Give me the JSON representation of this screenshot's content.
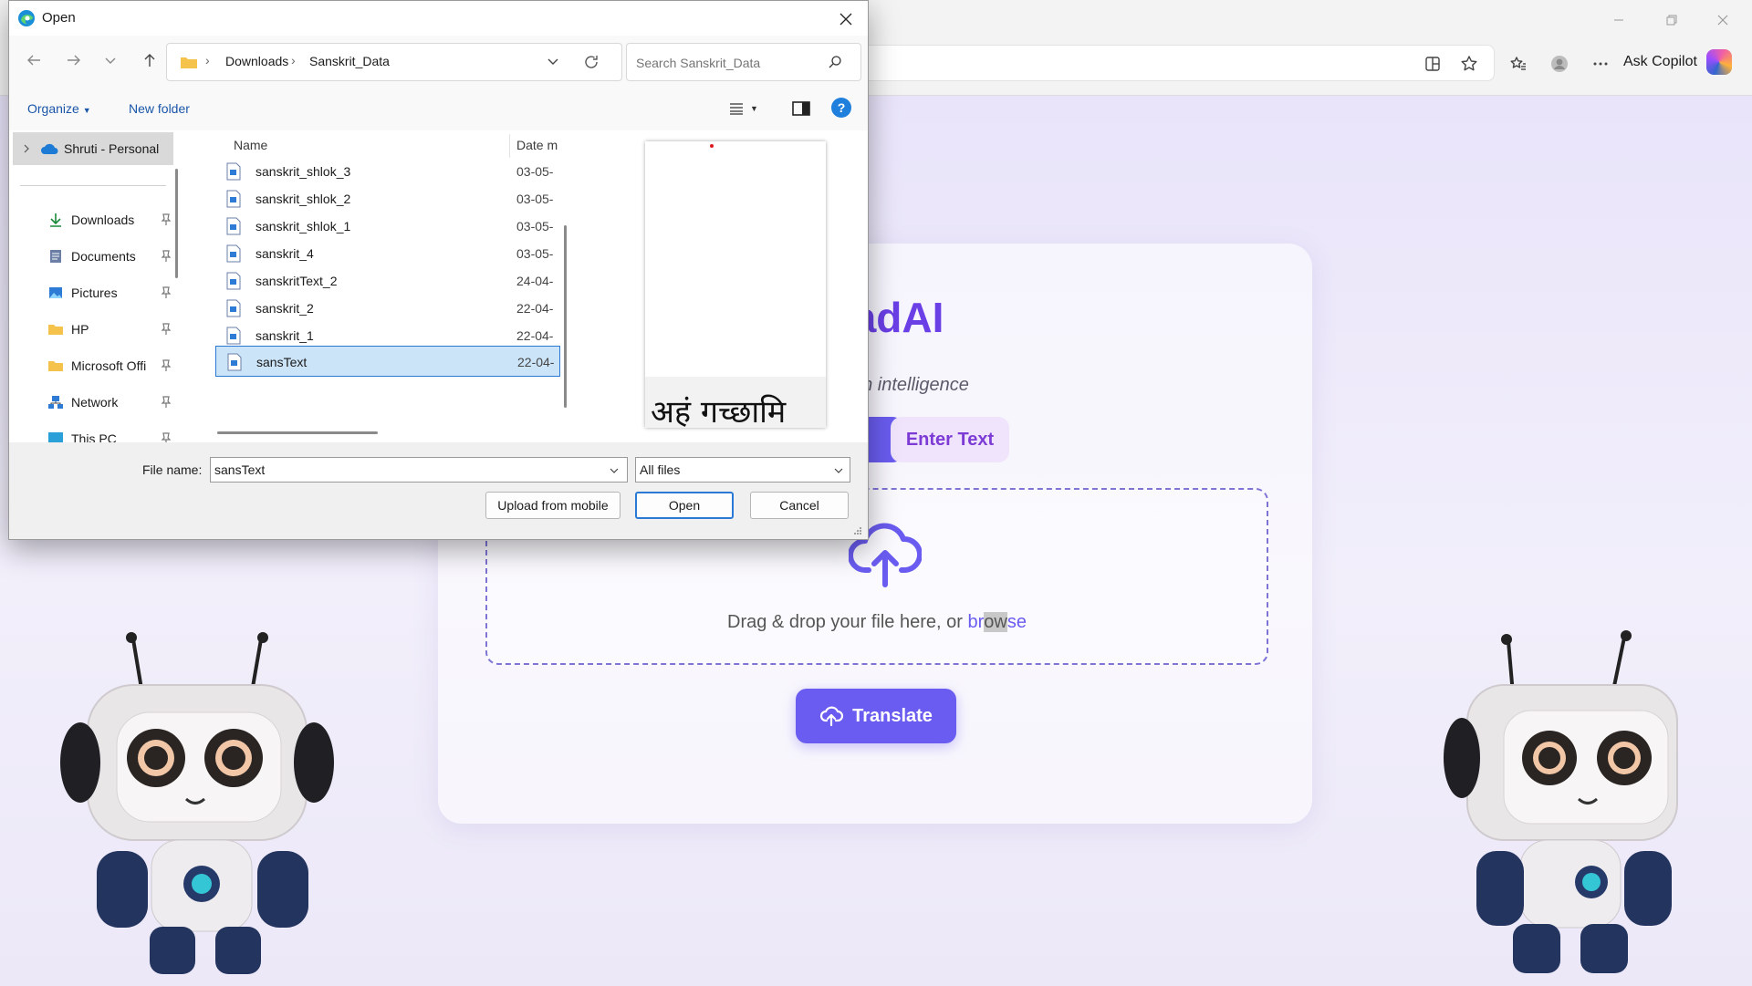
{
  "browser": {
    "ask_copilot_label": "Ask Copilot"
  },
  "app": {
    "title": "vaadAI",
    "subtitle": "ets modern intelligence",
    "tab_enter_text": "Enter Text",
    "drop_text": "Drag & drop your file here, or ",
    "browse_part1": "br",
    "browse_part2": "ow",
    "browse_part3": "se",
    "translate_label": "Translate"
  },
  "dialog": {
    "title": "Open",
    "breadcrumb": [
      "Downloads",
      "Sanskrit_Data"
    ],
    "search_placeholder": "Search Sanskrit_Data",
    "organize_label": "Organize",
    "new_folder_label": "New folder",
    "help_label": "?",
    "nav_pane": {
      "onedrive_label": "Shruti - Personal",
      "items": [
        {
          "label": "Downloads",
          "icon": "download-icon"
        },
        {
          "label": "Documents",
          "icon": "documents-icon"
        },
        {
          "label": "Pictures",
          "icon": "pictures-icon"
        },
        {
          "label": "HP",
          "icon": "folder-icon"
        },
        {
          "label": "Microsoft Offi",
          "icon": "folder-icon"
        },
        {
          "label": "Network",
          "icon": "network-icon"
        },
        {
          "label": "This PC",
          "icon": "this-pc-icon"
        }
      ]
    },
    "columns": {
      "name": "Name",
      "date": "Date m"
    },
    "files": [
      {
        "name": "sanskrit_shlok_3",
        "date": "03-05-"
      },
      {
        "name": "sanskrit_shlok_2",
        "date": "03-05-"
      },
      {
        "name": "sanskrit_shlok_1",
        "date": "03-05-"
      },
      {
        "name": "sanskrit_4",
        "date": "03-05-"
      },
      {
        "name": "sanskritText_2",
        "date": "24-04-"
      },
      {
        "name": "sanskrit_2",
        "date": "22-04-"
      },
      {
        "name": "sanskrit_1",
        "date": "22-04-"
      },
      {
        "name": "sansText",
        "date": "22-04-"
      }
    ],
    "selected_file": "sansText",
    "preview_text": "अहं गच्छामि",
    "file_name_label": "File name:",
    "file_name_value": "sansText",
    "file_type_value": "All files",
    "upload_mobile_label": "Upload from mobile",
    "open_label": "Open",
    "cancel_label": "Cancel"
  },
  "colors": {
    "accent": "#6a5cf0",
    "title": "#6a3fe6",
    "selection": "#cce4f7"
  }
}
